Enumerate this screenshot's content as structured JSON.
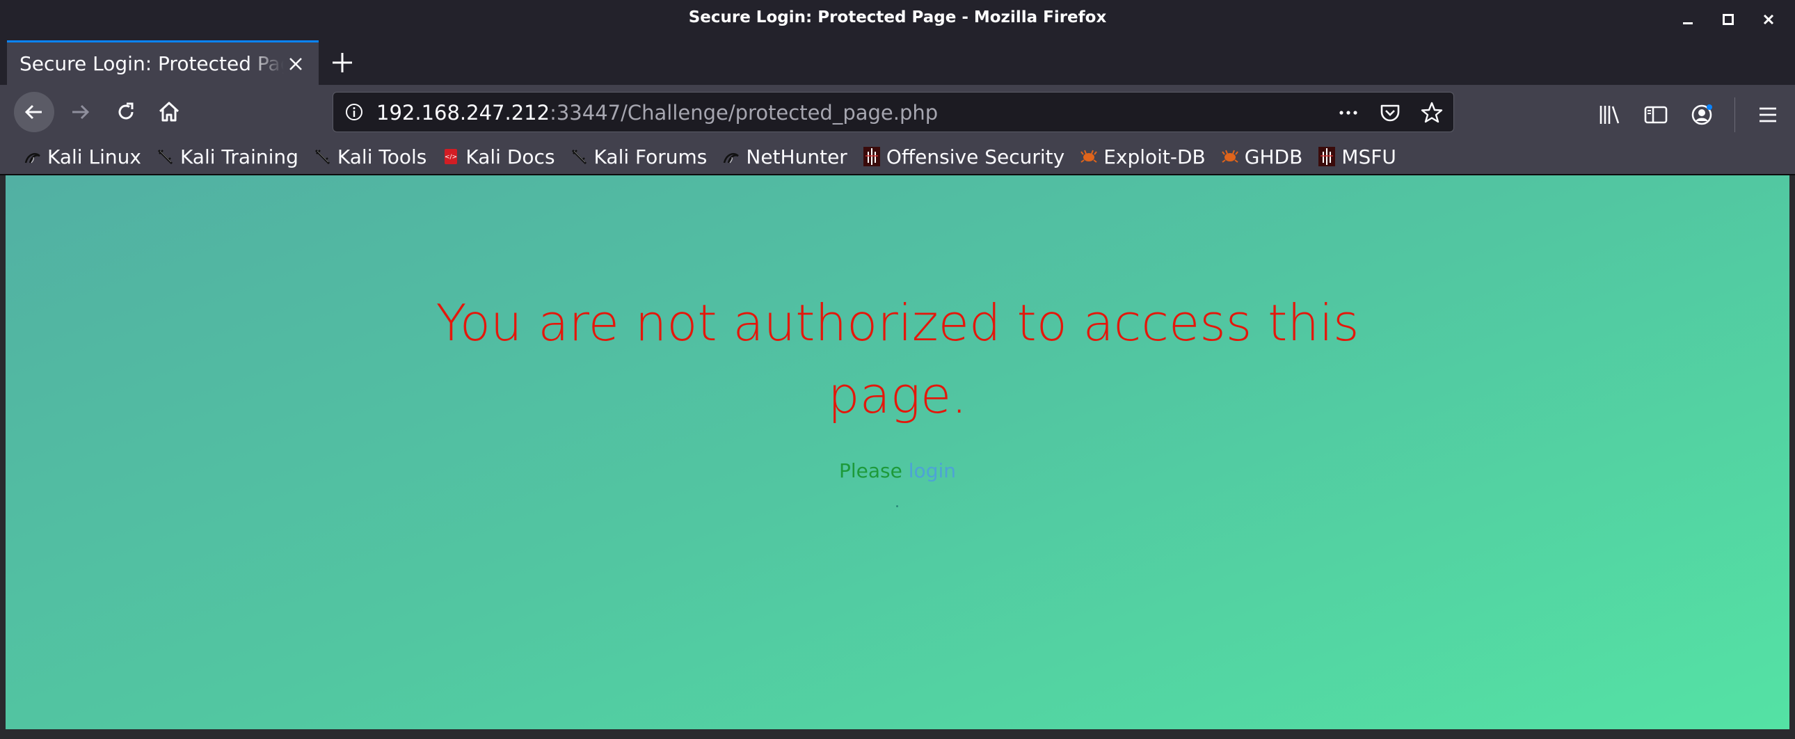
{
  "window": {
    "title": "Secure Login: Protected Page - Mozilla Firefox",
    "controls": [
      "minimize",
      "maximize",
      "close"
    ]
  },
  "tabs": [
    {
      "label": "Secure Login: Protected Page",
      "active": true
    }
  ],
  "navbar": {
    "url_host": "192.168.247.212",
    "url_rest": ":33447/Challenge/protected_page.php"
  },
  "bookmarks": [
    {
      "label": "Kali Linux",
      "icon": "kali-dragon-icon"
    },
    {
      "label": "Kali Training",
      "icon": "kali-sword-icon"
    },
    {
      "label": "Kali Tools",
      "icon": "kali-sword-icon"
    },
    {
      "label": "Kali Docs",
      "icon": "kali-docs-icon"
    },
    {
      "label": "Kali Forums",
      "icon": "kali-sword-icon"
    },
    {
      "label": "NetHunter",
      "icon": "kali-dragon-icon"
    },
    {
      "label": "Offensive Security",
      "icon": "offsec-icon"
    },
    {
      "label": "Exploit-DB",
      "icon": "exploitdb-icon"
    },
    {
      "label": "GHDB",
      "icon": "exploitdb-icon"
    },
    {
      "label": "MSFU",
      "icon": "offsec-icon"
    }
  ],
  "page": {
    "heading_line1": "You are not authorized to access this",
    "heading_line2": "page.",
    "please_text": "Please",
    "login_link": "login",
    "trailing": "."
  },
  "colors": {
    "heading": "#e4170b",
    "please": "#1d9a3a",
    "link": "#4da3d6",
    "tab_accent": "#0a84ff"
  }
}
